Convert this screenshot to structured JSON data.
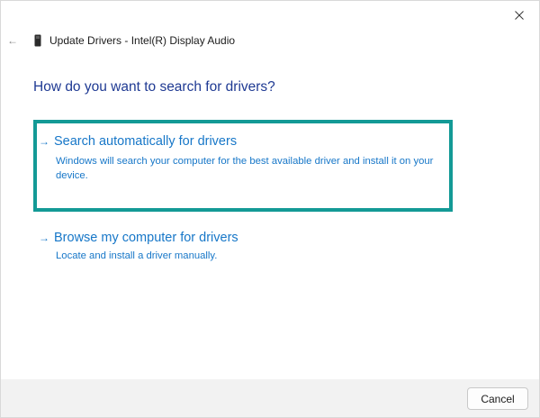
{
  "window": {
    "title": "Update Drivers - Intel(R) Display Audio",
    "back_glyph": "←",
    "close_icon": "close-icon",
    "device_icon": "audio-device-icon"
  },
  "main": {
    "heading": "How do you want to search for drivers?",
    "options": [
      {
        "arrow": "→",
        "title": "Search automatically for drivers",
        "description": "Windows will search your computer for the best available driver and install it on your device.",
        "selected": true
      },
      {
        "arrow": "→",
        "title": "Browse my computer for drivers",
        "description": "Locate and install a driver manually.",
        "selected": false
      }
    ]
  },
  "footer": {
    "cancel_label": "Cancel"
  },
  "colors": {
    "heading": "#1f3a93",
    "link": "#1777c8",
    "highlight_border": "#139a96",
    "footer_bg": "#f2f2f2"
  }
}
